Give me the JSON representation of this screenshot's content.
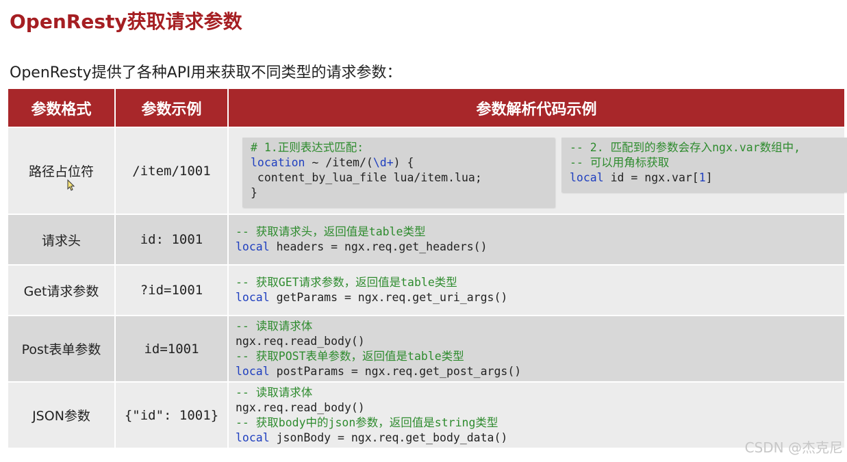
{
  "title": "OpenResty获取请求参数",
  "subtitle": "OpenResty提供了各种API用来获取不同类型的请求参数：",
  "table": {
    "headers": [
      "参数格式",
      "参数示例",
      "参数解析代码示例"
    ],
    "rows": [
      {
        "format": "路径占位符",
        "example": "/item/1001",
        "code_left": [
          "# 1.正则表达式匹配:",
          "location ~ /item/(\\d+) {",
          " content_by_lua_file lua/item.lua;",
          "}"
        ],
        "code_right": [
          "-- 2. 匹配到的参数会存入ngx.var数组中,",
          "-- 可以用角标获取",
          "local id = ngx.var[1]"
        ]
      },
      {
        "format": "请求头",
        "example": "id: 1001",
        "code": [
          "-- 获取请求头，返回值是table类型",
          "local headers = ngx.req.get_headers()"
        ]
      },
      {
        "format": "Get请求参数",
        "example": "?id=1001",
        "code": [
          "-- 获取GET请求参数，返回值是table类型",
          "local getParams = ngx.req.get_uri_args()"
        ]
      },
      {
        "format": "Post表单参数",
        "example": "id=1001",
        "code": [
          "-- 读取请求体",
          "ngx.req.read_body()",
          "-- 获取POST表单参数，返回值是table类型",
          "local postParams = ngx.req.get_post_args()"
        ]
      },
      {
        "format": "JSON参数",
        "example": "{\"id\": 1001}",
        "code": [
          "-- 读取请求体",
          "ngx.req.read_body()",
          "-- 获取body中的json参数，返回值是string类型",
          "local jsonBody = ngx.req.get_body_data()"
        ]
      }
    ]
  },
  "watermark": "CSDN @杰克尼",
  "colors": {
    "title": "#a51e22",
    "header_bg": "#a8272a",
    "comment": "#2e8b2e",
    "keyword": "#1f3fbf"
  }
}
